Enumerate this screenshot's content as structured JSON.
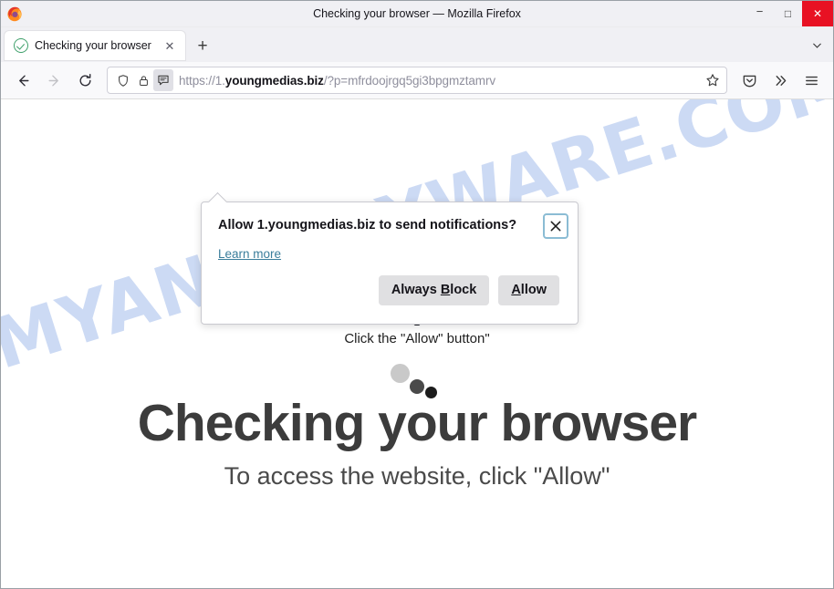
{
  "window": {
    "title": "Checking your browser — Mozilla Firefox",
    "logo_icon": "firefox-logo-icon",
    "controls": {
      "minimize": "−",
      "maximize": "□",
      "close": "✕"
    }
  },
  "tabbar": {
    "tab": {
      "favicon_icon": "check-circle-favicon-icon",
      "title": "Checking your browser",
      "close_glyph": "✕"
    },
    "new_tab_glyph": "+",
    "list_all_tabs_glyph": "⌄"
  },
  "toolbar": {
    "back_glyph": "←",
    "forward_glyph": "→",
    "reload_glyph": "⟳",
    "urlbar": {
      "shield_icon": "shield-icon",
      "lock_icon": "lock-icon",
      "notification_icon": "notification-bubble-icon",
      "url_scheme": "https://1.",
      "url_host": "youngmedias.biz",
      "url_path": "/?p=mfrdoojrgq5gi3bpgmztamrv",
      "bookmark_glyph": "☆"
    },
    "pocket_icon": "pocket-icon",
    "overflow_glyph": "»",
    "menu_glyph": "☰"
  },
  "doorhanger": {
    "title": "Allow 1.youngmedias.biz to send notifications?",
    "close_glyph": "✕",
    "learn_more": "Learn more",
    "always_block": {
      "prefix": "Always ",
      "accesskey": "B",
      "suffix": "lock"
    },
    "allow": {
      "prefix": "",
      "accesskey": "A",
      "suffix": "llow"
    }
  },
  "page": {
    "watermark": "MYANTISPYWARE.COM",
    "arrow_icon": "up-arrow-icon",
    "arrow_caption": "Click the \"Allow\" button\"",
    "spinner_icon": "loading-dots-spinner-icon",
    "headline": "Checking your browser",
    "subline": "To access the website, click \"Allow\"",
    "colors": {
      "watermark": "#ccdaf4",
      "headline": "#3c3c3c",
      "link": "#3a7d9b",
      "close_button_focus": "#8bbcd4",
      "favicon_green": "#3fa06b",
      "window_close_red": "#e81123"
    }
  }
}
